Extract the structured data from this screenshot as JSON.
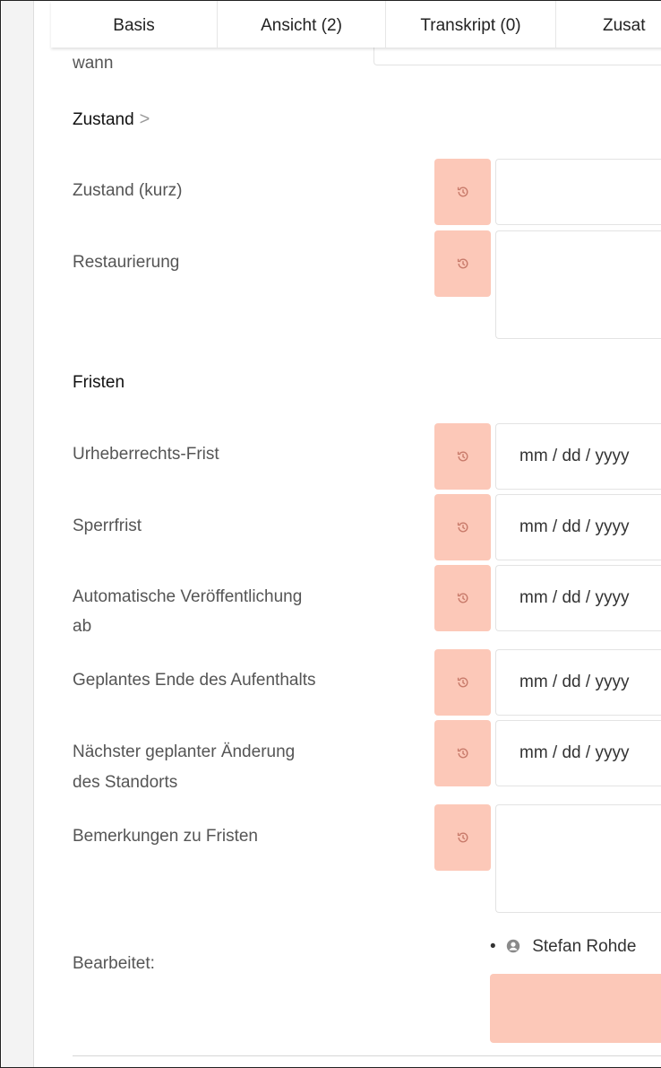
{
  "tabs": [
    {
      "label": "Basis"
    },
    {
      "label": "Ansicht (2)"
    },
    {
      "label": "Transkript (0)"
    },
    {
      "label": "Zusat"
    }
  ],
  "partial_label": "wann",
  "sections": {
    "zustand": "Zustand",
    "zustand_chevron": ">",
    "fristen": "Fristen"
  },
  "fields": {
    "zustand_kurz": {
      "label": "Zustand (kurz)",
      "value": ""
    },
    "restaurierung": {
      "label": "Restaurierung",
      "value": ""
    },
    "urheberrechts_frist": {
      "label": "Urheberrechts-Frist",
      "placeholder": "mm / dd / yyyy"
    },
    "sperrfrist": {
      "label": "Sperrfrist",
      "placeholder": "mm / dd / yyyy"
    },
    "auto_veroeffentlichung": {
      "label_line1": "Automatische Veröffentlichung",
      "label_line2": "ab",
      "placeholder": "mm / dd / yyyy"
    },
    "geplantes_ende": {
      "label": "Geplantes Ende des Aufenthalts",
      "placeholder": "mm / dd / yyyy"
    },
    "naechste_aenderung": {
      "label_line1": "Nächster geplanter Änderung",
      "label_line2": "des Standorts",
      "placeholder": "mm / dd / yyyy"
    },
    "bemerkungen": {
      "label": "Bemerkungen zu Fristen",
      "value": ""
    }
  },
  "edited": {
    "label": "Bearbeitet:",
    "bullet": "•",
    "user": "Stefan Rohde"
  },
  "colors": {
    "history_button": "#fcc8b8",
    "save_button": "#fcc8b8"
  },
  "icons": {
    "history": "history-icon",
    "user": "user-circle-icon"
  }
}
